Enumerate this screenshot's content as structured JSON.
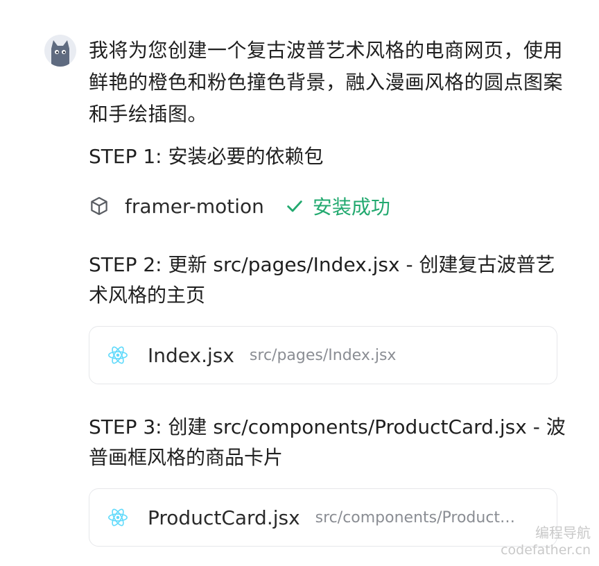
{
  "assistant": {
    "avatar_icon": "cat-avatar-icon"
  },
  "message": {
    "intro": "我将为您创建一个复古波普艺术风格的电商网页，使用鲜艳的橙色和粉色撞色背景，融入漫画风格的圆点图案和手绘插图。",
    "steps": [
      {
        "title": "STEP 1: 安装必要的依赖包",
        "package": {
          "icon": "package-cube-icon",
          "name": "framer-motion",
          "status_icon": "check-icon",
          "status": "安装成功"
        }
      },
      {
        "title": "STEP 2: 更新 src/pages/Index.jsx - 创建复古波普艺术风格的主页",
        "file": {
          "icon": "react-icon",
          "name": "Index.jsx",
          "path": "src/pages/Index.jsx"
        }
      },
      {
        "title": "STEP 3: 创建 src/components/ProductCard.jsx - 波普画框风格的商品卡片",
        "file": {
          "icon": "react-icon",
          "name": "ProductCard.jsx",
          "path": "src/components/Product…"
        }
      }
    ]
  },
  "watermark": {
    "line1": "编程导航",
    "line2": "codefather.cn"
  },
  "colors": {
    "success": "#22a96f",
    "react": "#61dafb",
    "avatar_bg": "#e9ecf2",
    "card_border": "#e6e7ea"
  }
}
